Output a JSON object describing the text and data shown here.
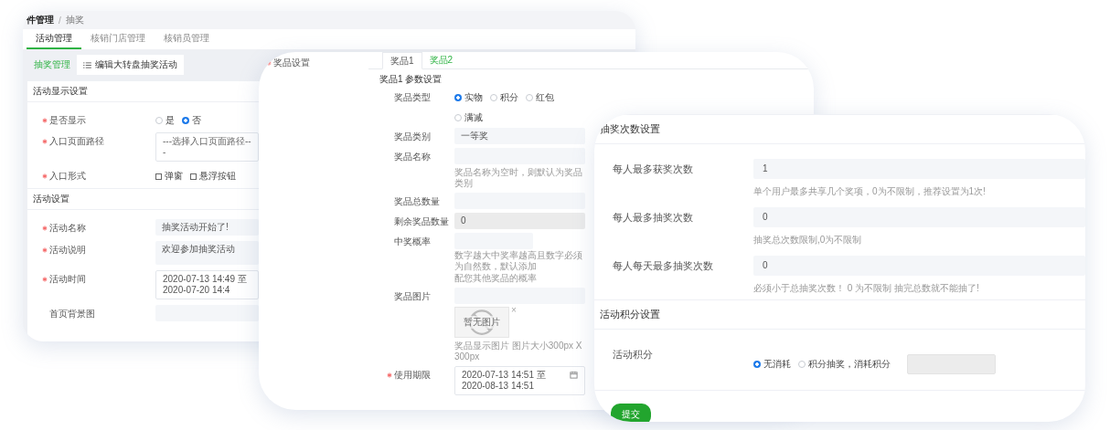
{
  "activity_card": {
    "breadcrumb": {
      "items": [
        "件管理",
        "抽奖"
      ],
      "separator": "/"
    },
    "tabs": [
      {
        "label": "活动管理",
        "selected": true
      },
      {
        "label": "核销门店管理",
        "selected": false
      },
      {
        "label": "核销员管理",
        "selected": false
      }
    ],
    "subtabs": [
      {
        "label": "抽奖管理",
        "selected": false
      },
      {
        "label": "编辑大转盘抽奖活动",
        "selected": true
      }
    ],
    "sections": [
      {
        "title": "活动显示设置",
        "fields": [
          {
            "label": "是否显示",
            "required": true,
            "kind": "radio",
            "options": [
              {
                "label": "是",
                "selected": false
              },
              {
                "label": "否",
                "selected": true
              }
            ]
          },
          {
            "label": "入口页面路径",
            "required": true,
            "kind": "select",
            "placeholder": "---选择入口页面路径---"
          },
          {
            "label": "入口形式",
            "required": true,
            "kind": "checkbox",
            "options": [
              {
                "label": "弹窗",
                "checked": false
              },
              {
                "label": "悬浮按钮",
                "checked": false
              }
            ]
          }
        ]
      },
      {
        "title": "活动设置",
        "fields": [
          {
            "label": "活动名称",
            "required": true,
            "kind": "input",
            "value": "抽奖活动开始了!"
          },
          {
            "label": "活动说明",
            "required": true,
            "kind": "textarea",
            "value": "欢迎参加抽奖活动"
          },
          {
            "label": "活动时间",
            "required": true,
            "kind": "date",
            "value": "2020-07-13 14:49 至 2020-07-20 14:4"
          },
          {
            "label": "首页背景图",
            "required": false,
            "kind": "input"
          }
        ]
      }
    ]
  },
  "prize_card": {
    "label": "奖品设置",
    "required": true,
    "tabs": [
      {
        "label": "奖品1",
        "selected": true
      },
      {
        "label": "奖品2",
        "selected": false
      }
    ],
    "heading": "奖品1 参数设置",
    "fields": [
      {
        "label": "奖品类型",
        "required": false,
        "kind": "radio",
        "options": [
          {
            "label": "实物",
            "selected": true
          },
          {
            "label": "积分",
            "selected": false
          },
          {
            "label": "红包",
            "selected": false
          },
          {
            "label": "满减",
            "selected": false
          }
        ]
      },
      {
        "label": "奖品类别",
        "required": false,
        "kind": "input",
        "disabled": false,
        "value": "一等奖"
      },
      {
        "label": "奖品名称",
        "required": false,
        "kind": "input",
        "disabled": false,
        "hint": "奖品名称为空时，则默认为奖品类别"
      },
      {
        "label": "奖品总数量",
        "required": false,
        "kind": "input",
        "disabled": false
      },
      {
        "label": "剩余奖品数量",
        "required": false,
        "kind": "input",
        "disabled": true,
        "value": "0"
      },
      {
        "label": "中奖概率",
        "required": false,
        "kind": "short",
        "disabled": false,
        "hint_lines": [
          "数字越大中奖率越高且数字必须为自然数，默认添加",
          "配您其他奖品的概率"
        ]
      },
      {
        "label": "奖品图片",
        "required": false,
        "kind": "image",
        "disabled": false,
        "image_text": "暂无图片",
        "remove": "×",
        "hint": "奖品显示图片 图片大小300px X 300px"
      },
      {
        "label": "使用期限",
        "required": true,
        "kind": "date",
        "value": "2020-07-13 14:51 至 2020-08-13 14:51"
      }
    ]
  },
  "limits_card": {
    "sections": [
      {
        "title": "抽奖次数设置",
        "fields": [
          {
            "label": "每人最多获奖次数",
            "kind": "input",
            "disabled": false,
            "value": "1",
            "hint": "单个用户最多共享几个奖项，0为不限制，推荐设置为1次!"
          },
          {
            "label": "每人最多抽奖次数",
            "kind": "input",
            "disabled": false,
            "value": "0",
            "hint": "抽奖总次数限制,0为不限制"
          },
          {
            "label": "每人每天最多抽奖次数",
            "kind": "input",
            "disabled": false,
            "value": "0",
            "hint": "必须小于总抽奖次数！ 0 为不限制 抽完总数就不能抽了!"
          }
        ]
      },
      {
        "title": "活动积分设置",
        "fields": [
          {
            "label": "活动积分",
            "kind": "points",
            "options": [
              {
                "label": "无消耗",
                "selected": true
              },
              {
                "label": "积分抽奖，消耗积分",
                "selected": false
              }
            ],
            "amount_disabled": true
          }
        ]
      }
    ],
    "submit": "提交"
  }
}
